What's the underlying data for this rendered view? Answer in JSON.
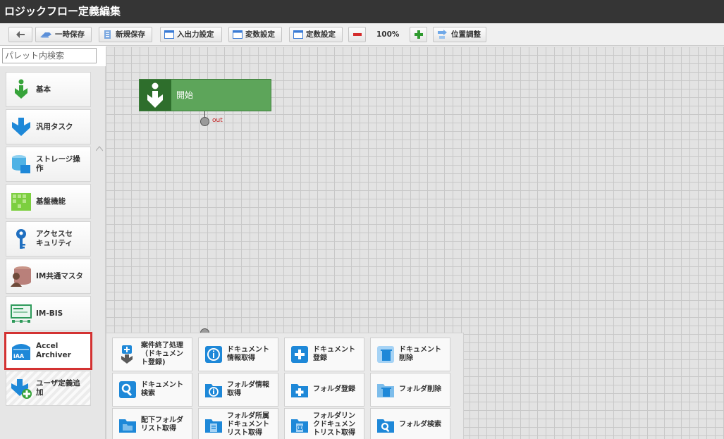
{
  "window": {
    "title": "ロジックフロー定義編集"
  },
  "toolbar": {
    "temp_save": "一時保存",
    "new_save": "新規保存",
    "io_settings": "入出力設定",
    "var_settings": "変数設定",
    "const_settings": "定数設定",
    "zoom": "100%",
    "position_adjust": "位置調整"
  },
  "search": {
    "placeholder": "パレット内検索"
  },
  "palette": {
    "items": [
      {
        "label": "基本",
        "icon": "green-down-arrow-icon"
      },
      {
        "label": "汎用タスク",
        "icon": "blue-down-arrow-icon"
      },
      {
        "label": "ストレージ操\n作",
        "icon": "storage-icon"
      },
      {
        "label": "基盤機能",
        "icon": "green-grid-icon"
      },
      {
        "label": "アクセスセ\nキュリティ",
        "icon": "key-icon"
      },
      {
        "label": "IM共通マスタ",
        "icon": "database-user-icon"
      },
      {
        "label": "IM-BIS",
        "icon": "bis-flow-icon"
      },
      {
        "label": "Accel\nArchiver",
        "icon": "accel-archiver-icon"
      },
      {
        "label": "ユーザ定義追\n加",
        "icon": "user-defined-add-icon"
      }
    ]
  },
  "canvas": {
    "start_node": {
      "label": "開始",
      "port": "out"
    }
  },
  "flyout": {
    "items": [
      {
        "label": "案件終了処理\n（ドキュメン\nト登録)",
        "icon": "case-end-icon"
      },
      {
        "label": "ドキュメント\n情報取得",
        "icon": "document-info-icon"
      },
      {
        "label": "ドキュメント\n登録",
        "icon": "document-register-icon"
      },
      {
        "label": "ドキュメント\n削除",
        "icon": "document-delete-icon"
      },
      {
        "label": "ドキュメント\n検索",
        "icon": "document-search-icon"
      },
      {
        "label": "フォルダ情報\n取得",
        "icon": "folder-info-icon"
      },
      {
        "label": "フォルダ登録",
        "icon": "folder-register-icon"
      },
      {
        "label": "フォルダ削除",
        "icon": "folder-delete-icon"
      },
      {
        "label": "配下フォルダ\nリスト取得",
        "icon": "subfolder-list-icon"
      },
      {
        "label": "フォルダ所属\nドキュメント\nリスト取得",
        "icon": "folder-document-list-icon"
      },
      {
        "label": "フォルダリン\nクドキュメン\nトリスト取得",
        "icon": "folder-link-document-list-icon"
      },
      {
        "label": "フォルダ検索",
        "icon": "folder-search-icon"
      }
    ]
  },
  "colors": {
    "titlebar": "#353535",
    "start_node": "#5da55a",
    "selection": "#d33232",
    "icon_blue": "#1e88d8"
  }
}
